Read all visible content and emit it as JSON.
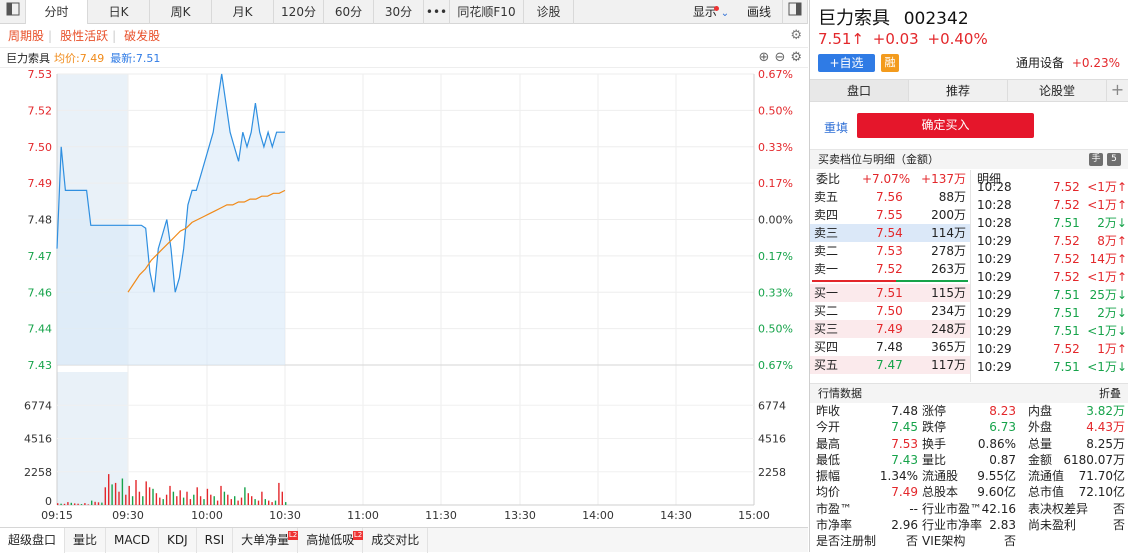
{
  "tabs": [
    "分时",
    "日K",
    "周K",
    "月K",
    "120分",
    "60分",
    "30分",
    "•••",
    "同花顺F10",
    "诊股"
  ],
  "display_label": "显示",
  "draw_label": "画线",
  "tags": [
    "周期股",
    "股性活跃",
    "破发股"
  ],
  "chart_header": {
    "name": "巨力索具",
    "avg": "均价:7.49",
    "latest": "最新:7.51"
  },
  "price_axis": {
    "left": [
      "7.53",
      "7.52",
      "7.50",
      "7.49",
      "7.48",
      "7.47",
      "7.46",
      "7.44",
      "7.43"
    ],
    "right": [
      "0.67%",
      "0.50%",
      "0.33%",
      "0.17%",
      "0.00%",
      "0.17%",
      "0.33%",
      "0.50%",
      "0.67%"
    ]
  },
  "volume_axis": [
    "6774",
    "4516",
    "2258",
    "0"
  ],
  "time_axis": [
    "09:15",
    "09:30",
    "10:00",
    "10:30",
    "11:00",
    "11:30",
    "13:30",
    "14:00",
    "14:30",
    "15:00"
  ],
  "chart_data": {
    "type": "line",
    "price_range": [
      7.43,
      7.53
    ],
    "prev_close": 7.48,
    "price_series": [
      7.47,
      7.505,
      7.49,
      7.49,
      7.49,
      7.49,
      7.49,
      7.49,
      7.478,
      7.478,
      7.478,
      7.478,
      7.478,
      7.478,
      7.478,
      7.478,
      7.478,
      7.478,
      7.478,
      7.478,
      7.478,
      7.477,
      7.462,
      7.455,
      7.47,
      7.475,
      7.48,
      7.47,
      7.455,
      7.46,
      7.47,
      7.485,
      7.49,
      7.49,
      7.495,
      7.5,
      7.505,
      7.51,
      7.52,
      7.53,
      7.52,
      7.51,
      7.505,
      7.5,
      7.51,
      7.505,
      7.51,
      7.52,
      7.51,
      7.505,
      7.51,
      7.505,
      7.51,
      7.51,
      7.51
    ],
    "avg_series": [
      7.455,
      7.458,
      7.461,
      7.463,
      7.466,
      7.468,
      7.47,
      7.472,
      7.474,
      7.476,
      7.477,
      7.479,
      7.48,
      7.481,
      7.482,
      7.483,
      7.484,
      7.485,
      7.485,
      7.486,
      7.486,
      7.487,
      7.487,
      7.488,
      7.488,
      7.489,
      7.489,
      7.49
    ],
    "volumes": [
      120,
      90,
      80,
      200,
      150,
      110,
      90,
      60,
      130,
      40,
      300,
      220,
      180,
      160,
      1200,
      2100,
      1400,
      1500,
      900,
      1800,
      700,
      1300,
      600,
      1700,
      900,
      600,
      1600,
      1200,
      1100,
      800,
      500,
      400,
      700,
      1300,
      900,
      600,
      1000,
      500,
      900,
      400,
      700,
      1200,
      600,
      400,
      1100,
      700,
      600,
      300,
      1300,
      900,
      700,
      400,
      600,
      300,
      500,
      1200,
      800,
      600,
      400,
      300,
      900,
      400,
      300,
      200,
      300,
      1500,
      900,
      200
    ]
  },
  "bottom_tabs": [
    "超级盘口",
    "量比",
    "MACD",
    "KDJ",
    "RSI",
    "大单净量",
    "高抛低吸",
    "成交对比"
  ],
  "right": {
    "name": "巨力索具",
    "code": "002342",
    "price": "7.51↑",
    "change": "+0.03",
    "pct": "+0.40%",
    "add": "+自选",
    "rong": "融",
    "sector": "通用设备",
    "sector_pct": "+0.23%",
    "tabs": [
      "盘口",
      "推荐",
      "论股堂",
      "+"
    ],
    "refill": "重填",
    "buy": "确定买入",
    "ob_title": "买卖档位与明细（金额）",
    "ob_icon1": "手",
    "ob_icon2": "5",
    "weibi": {
      "label": "委比",
      "pct": "+7.07%",
      "val": "+137万"
    },
    "sells": [
      {
        "l": "卖五",
        "p": "7.56",
        "v": "88万"
      },
      {
        "l": "卖四",
        "p": "7.55",
        "v": "200万"
      },
      {
        "l": "卖三",
        "p": "7.54",
        "v": "114万"
      },
      {
        "l": "卖二",
        "p": "7.53",
        "v": "278万"
      },
      {
        "l": "卖一",
        "p": "7.52",
        "v": "263万"
      }
    ],
    "buys": [
      {
        "l": "买一",
        "p": "7.51",
        "v": "115万"
      },
      {
        "l": "买二",
        "p": "7.50",
        "v": "234万"
      },
      {
        "l": "买三",
        "p": "7.49",
        "v": "248万"
      },
      {
        "l": "买四",
        "p": "7.48",
        "v": "365万"
      },
      {
        "l": "买五",
        "p": "7.47",
        "v": "117万"
      }
    ],
    "detail_label": "明细",
    "ticks": [
      {
        "t": "10:28",
        "p": "7.52",
        "v": "<1万↑",
        "c": "red"
      },
      {
        "t": "10:28",
        "p": "7.52",
        "v": "<1万↑",
        "c": "red"
      },
      {
        "t": "10:28",
        "p": "7.51",
        "v": "2万↓",
        "c": "green"
      },
      {
        "t": "10:29",
        "p": "7.52",
        "v": "8万↑",
        "c": "red"
      },
      {
        "t": "10:29",
        "p": "7.52",
        "v": "14万↑",
        "c": "red"
      },
      {
        "t": "10:29",
        "p": "7.52",
        "v": "<1万↑",
        "c": "red"
      },
      {
        "t": "10:29",
        "p": "7.51",
        "v": "25万↓",
        "c": "green"
      },
      {
        "t": "10:29",
        "p": "7.51",
        "v": "2万↓",
        "c": "green"
      },
      {
        "t": "10:29",
        "p": "7.51",
        "v": "<1万↓",
        "c": "green"
      },
      {
        "t": "10:29",
        "p": "7.52",
        "v": "1万↑",
        "c": "red"
      },
      {
        "t": "10:29",
        "p": "7.51",
        "v": "<1万↓",
        "c": "green"
      }
    ],
    "stats_title": "行情数据",
    "stats_fold": "折叠",
    "stats": [
      [
        {
          "k": "昨收",
          "v": "7.48",
          "c": ""
        },
        {
          "k": "涨停",
          "v": "8.23",
          "c": "red"
        },
        {
          "k": "内盘",
          "v": "3.82万",
          "c": "green"
        }
      ],
      [
        {
          "k": "今开",
          "v": "7.45",
          "c": "green"
        },
        {
          "k": "跌停",
          "v": "6.73",
          "c": "green"
        },
        {
          "k": "外盘",
          "v": "4.43万",
          "c": "red"
        }
      ],
      [
        {
          "k": "最高",
          "v": "7.53",
          "c": "red"
        },
        {
          "k": "换手",
          "v": "0.86%",
          "c": ""
        },
        {
          "k": "总量",
          "v": "8.25万",
          "c": ""
        }
      ],
      [
        {
          "k": "最低",
          "v": "7.43",
          "c": "green"
        },
        {
          "k": "量比",
          "v": "0.87",
          "c": ""
        },
        {
          "k": "金额",
          "v": "6180.07万",
          "c": ""
        }
      ],
      [
        {
          "k": "振幅",
          "v": "1.34%",
          "c": ""
        },
        {
          "k": "流通股",
          "v": "9.55亿",
          "c": ""
        },
        {
          "k": "流通值",
          "v": "71.70亿",
          "c": ""
        }
      ],
      [
        {
          "k": "均价",
          "v": "7.49",
          "c": "red"
        },
        {
          "k": "总股本",
          "v": "9.60亿",
          "c": ""
        },
        {
          "k": "总市值",
          "v": "72.10亿",
          "c": ""
        }
      ],
      [
        {
          "k": "市盈™",
          "v": "--",
          "c": ""
        },
        {
          "k": "行业市盈™",
          "v": "42.16",
          "c": ""
        },
        {
          "k": "表决权差异",
          "v": "否",
          "c": ""
        }
      ],
      [
        {
          "k": "市净率",
          "v": "2.96",
          "c": ""
        },
        {
          "k": "行业市净率",
          "v": "2.83",
          "c": ""
        },
        {
          "k": "尚未盈利",
          "v": "否",
          "c": ""
        }
      ],
      [
        {
          "k": "是否注册制",
          "v": "否",
          "c": ""
        },
        {
          "k": "VIE架构",
          "v": "否",
          "c": ""
        },
        {
          "k": "",
          "v": "",
          "c": ""
        }
      ]
    ]
  }
}
